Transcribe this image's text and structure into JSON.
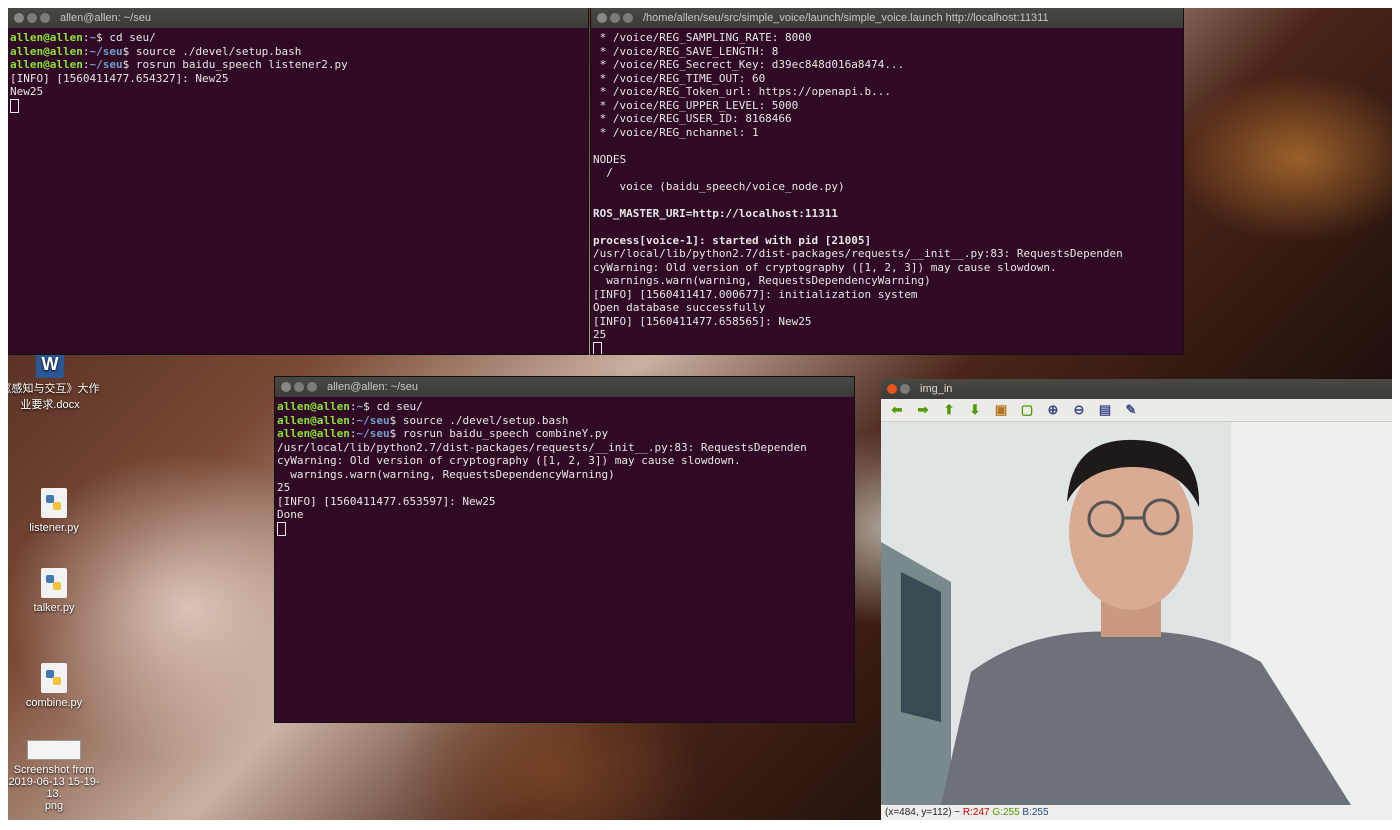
{
  "term1": {
    "title": "allen@allen: ~/seu",
    "lines": [
      {
        "type": "prompt",
        "user": "allen@allen",
        "path": "~",
        "cmd": " cd seu/"
      },
      {
        "type": "prompt",
        "user": "allen@allen",
        "path": "~/seu",
        "cmd": " source ./devel/setup.bash"
      },
      {
        "type": "prompt",
        "user": "allen@allen",
        "path": "~/seu",
        "cmd": " rosrun baidu_speech listener2.py"
      },
      {
        "type": "text",
        "text": "[INFO] [1560411477.654327]: New25"
      },
      {
        "type": "text",
        "text": "New25"
      },
      {
        "type": "cursor"
      }
    ]
  },
  "term2": {
    "title": "/home/allen/seu/src/simple_voice/launch/simple_voice.launch http://localhost:11311",
    "lines": [
      {
        "type": "text",
        "text": " * /voice/REG_SAMPLING_RATE: 8000"
      },
      {
        "type": "text",
        "text": " * /voice/REG_SAVE_LENGTH: 8"
      },
      {
        "type": "text",
        "text": " * /voice/REG_Secrect_Key: d39ec848d016a8474..."
      },
      {
        "type": "text",
        "text": " * /voice/REG_TIME_OUT: 60"
      },
      {
        "type": "text",
        "text": " * /voice/REG_Token_url: https://openapi.b..."
      },
      {
        "type": "text",
        "text": " * /voice/REG_UPPER_LEVEL: 5000"
      },
      {
        "type": "text",
        "text": " * /voice/REG_USER_ID: 8168466"
      },
      {
        "type": "text",
        "text": " * /voice/REG_nchannel: 1"
      },
      {
        "type": "text",
        "text": ""
      },
      {
        "type": "text",
        "text": "NODES"
      },
      {
        "type": "text",
        "text": "  /"
      },
      {
        "type": "text",
        "text": "    voice (baidu_speech/voice_node.py)"
      },
      {
        "type": "text",
        "text": ""
      },
      {
        "type": "bold",
        "text": "ROS_MASTER_URI=http://localhost:11311"
      },
      {
        "type": "text",
        "text": ""
      },
      {
        "type": "bold",
        "text": "process[voice-1]: started with pid [21005]"
      },
      {
        "type": "text",
        "text": "/usr/local/lib/python2.7/dist-packages/requests/__init__.py:83: RequestsDependen"
      },
      {
        "type": "text",
        "text": "cyWarning: Old version of cryptography ([1, 2, 3]) may cause slowdown."
      },
      {
        "type": "text",
        "text": "  warnings.warn(warning, RequestsDependencyWarning)"
      },
      {
        "type": "text",
        "text": "[INFO] [1560411417.000677]: initialization system"
      },
      {
        "type": "text",
        "text": "Open database successfully"
      },
      {
        "type": "text",
        "text": "[INFO] [1560411477.658565]: New25"
      },
      {
        "type": "text",
        "text": "25"
      },
      {
        "type": "cursor"
      }
    ]
  },
  "term3": {
    "title": "allen@allen: ~/seu",
    "lines": [
      {
        "type": "prompt",
        "user": "allen@allen",
        "path": "~",
        "cmd": " cd seu/"
      },
      {
        "type": "prompt",
        "user": "allen@allen",
        "path": "~/seu",
        "cmd": " source ./devel/setup.bash"
      },
      {
        "type": "prompt",
        "user": "allen@allen",
        "path": "~/seu",
        "cmd": " rosrun baidu_speech combineY.py"
      },
      {
        "type": "text",
        "text": "/usr/local/lib/python2.7/dist-packages/requests/__init__.py:83: RequestsDependen"
      },
      {
        "type": "text",
        "text": "cyWarning: Old version of cryptography ([1, 2, 3]) may cause slowdown."
      },
      {
        "type": "text",
        "text": "  warnings.warn(warning, RequestsDependencyWarning)"
      },
      {
        "type": "text",
        "text": "25"
      },
      {
        "type": "text",
        "text": "[INFO] [1560411477.653597]: New25"
      },
      {
        "type": "text",
        "text": "Done"
      },
      {
        "type": "cursor"
      }
    ]
  },
  "desktop_icons": {
    "docx": {
      "line1": "《感知与交互》大作",
      "line2": "业要求.docx",
      "glyph": "W"
    },
    "listener": "listener.py",
    "talker": "talker.py",
    "combine": "combine.py",
    "screenshot": {
      "line1": "Screenshot from",
      "line2": "2019-06-13 15-19-13.",
      "line3": "png"
    }
  },
  "img_window": {
    "title": "img_in",
    "status_coords": "(x=484, y=112) ~ ",
    "status_r": "R:247",
    "status_g": "G:255",
    "status_b": "B:255"
  },
  "colors": {
    "terminal_bg": "#300a24",
    "prompt_green": "#8ae234",
    "path_blue": "#729fcf"
  }
}
